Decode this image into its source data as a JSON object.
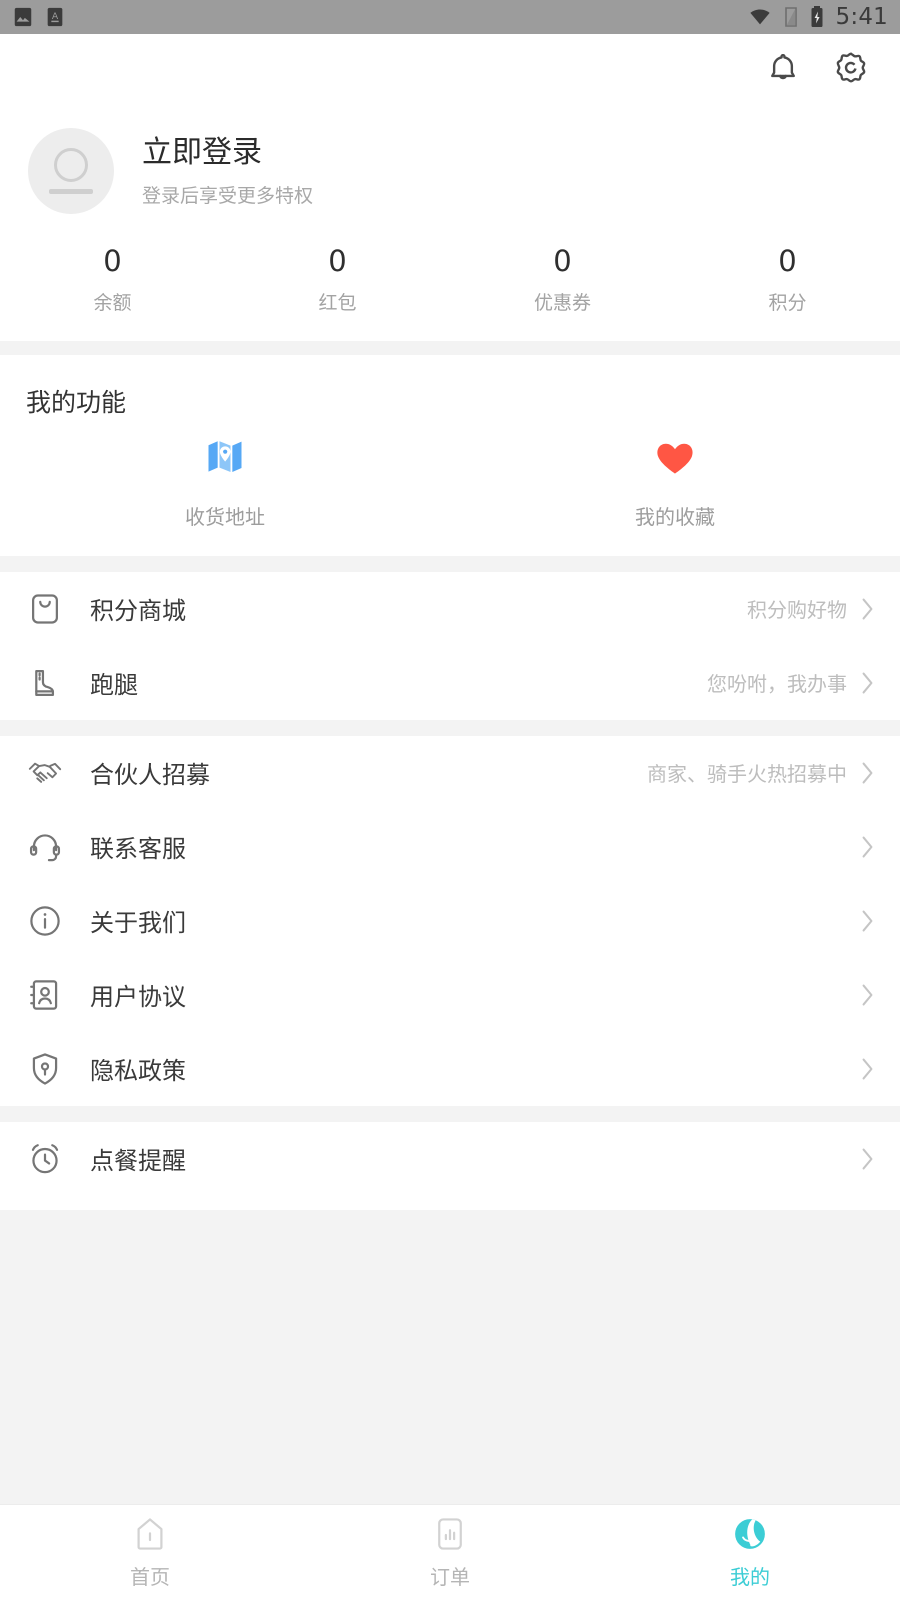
{
  "status_bar": {
    "time": "5:41",
    "icons": [
      "image-icon",
      "font-size-icon",
      "wifi-icon",
      "signal-icon",
      "battery-charging-icon"
    ]
  },
  "app_bar": {
    "notification_icon": "bell-icon",
    "settings_icon": "gear-icon"
  },
  "profile": {
    "avatar_icon": "default-avatar-icon",
    "title": "立即登录",
    "subtitle": "登录后享受更多特权"
  },
  "stats": [
    {
      "value": "0",
      "label": "余额"
    },
    {
      "value": "0",
      "label": "红包"
    },
    {
      "value": "0",
      "label": "优惠券"
    },
    {
      "value": "0",
      "label": "积分"
    }
  ],
  "functions": {
    "title": "我的功能",
    "items": [
      {
        "label": "收货地址",
        "icon": "map-location-icon",
        "color": "#56A8F5"
      },
      {
        "label": "我的收藏",
        "icon": "heart-icon",
        "color": "#FF5644"
      }
    ]
  },
  "menu_group_1": [
    {
      "label": "积分商城",
      "hint": "积分购好物",
      "icon": "shopping-bag-icon"
    },
    {
      "label": "跑腿",
      "hint": "您吩咐，我办事",
      "icon": "boot-icon"
    }
  ],
  "menu_group_2": [
    {
      "label": "合伙人招募",
      "hint": "商家、骑手火热招募中",
      "icon": "handshake-icon"
    },
    {
      "label": "联系客服",
      "hint": "",
      "icon": "headset-icon"
    },
    {
      "label": "关于我们",
      "hint": "",
      "icon": "info-circle-icon"
    },
    {
      "label": "用户协议",
      "hint": "",
      "icon": "user-card-icon"
    },
    {
      "label": "隐私政策",
      "hint": "",
      "icon": "shield-lock-icon"
    }
  ],
  "menu_group_3": [
    {
      "label": "点餐提醒",
      "hint": "",
      "icon": "alarm-clock-icon"
    }
  ],
  "tab_bar": {
    "active_color": "#3CCDD5",
    "inactive_color": "#B5B5B5",
    "items": [
      {
        "label": "首页",
        "icon": "home-icon",
        "active": false
      },
      {
        "label": "订单",
        "icon": "orders-chart-icon",
        "active": false
      },
      {
        "label": "我的",
        "icon": "profile-icon",
        "active": true
      }
    ]
  }
}
